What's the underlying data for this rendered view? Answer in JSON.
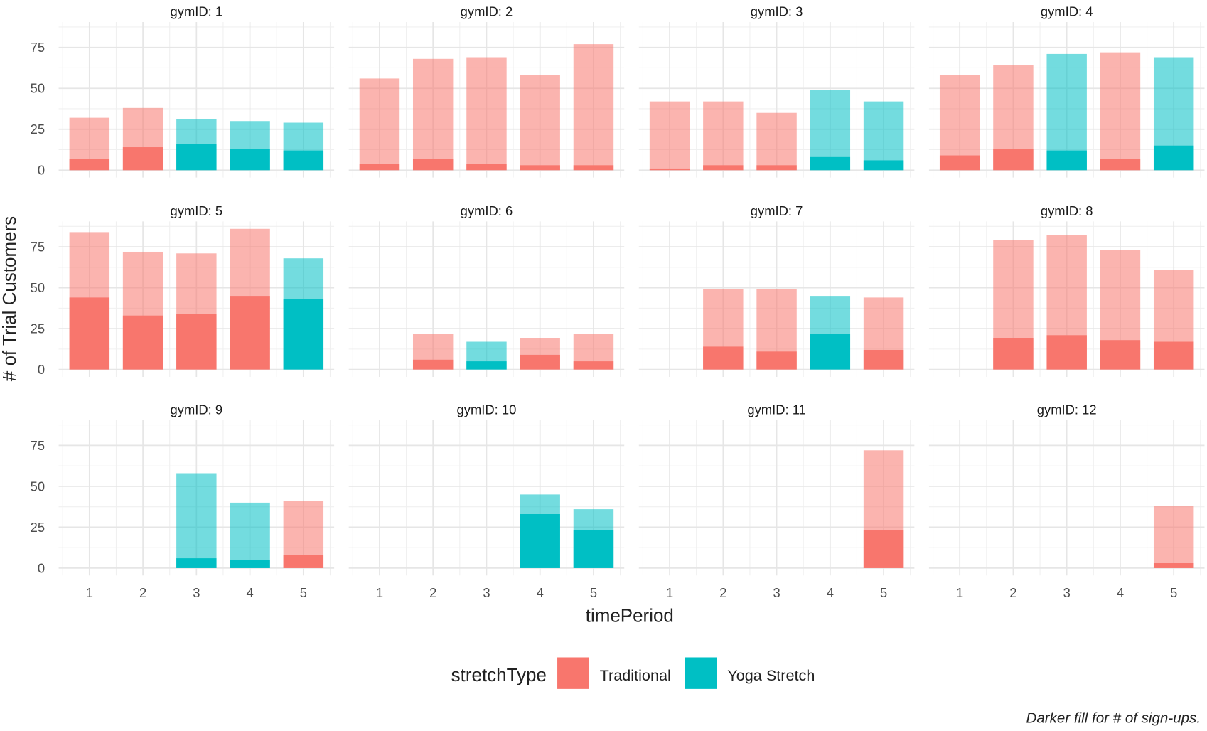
{
  "chart_data": {
    "type": "bar",
    "facet_label_prefix": "gymID: ",
    "xlabel": "timePeriod",
    "ylabel": "# of Trial Customers",
    "caption": "Darker fill for # of sign-ups.",
    "x_ticks": [
      1,
      2,
      3,
      4,
      5
    ],
    "y_ticks": [
      0,
      25,
      50,
      75
    ],
    "ylim": [
      0,
      90
    ],
    "grid": true,
    "legend": {
      "title": "stretchType",
      "placement": "bottom",
      "entries": [
        {
          "label": "Traditional",
          "color": "#F8766D"
        },
        {
          "label": "Yoga Stretch",
          "color": "#00BFC4"
        }
      ]
    },
    "series_note_fields": [
      "timePeriod",
      "total_trial_customers",
      "sign_ups",
      "stretchType"
    ],
    "panels": [
      {
        "gymID": 1,
        "bars": [
          [
            1,
            32,
            7,
            "Traditional"
          ],
          [
            2,
            38,
            14,
            "Traditional"
          ],
          [
            3,
            31,
            16,
            "Yoga Stretch"
          ],
          [
            4,
            30,
            13,
            "Yoga Stretch"
          ],
          [
            5,
            29,
            12,
            "Yoga Stretch"
          ]
        ]
      },
      {
        "gymID": 2,
        "bars": [
          [
            1,
            56,
            4,
            "Traditional"
          ],
          [
            2,
            68,
            7,
            "Traditional"
          ],
          [
            3,
            69,
            4,
            "Traditional"
          ],
          [
            4,
            58,
            3,
            "Traditional"
          ],
          [
            5,
            77,
            3,
            "Traditional"
          ]
        ]
      },
      {
        "gymID": 3,
        "bars": [
          [
            1,
            42,
            1,
            "Traditional"
          ],
          [
            2,
            42,
            3,
            "Traditional"
          ],
          [
            3,
            35,
            3,
            "Traditional"
          ],
          [
            4,
            49,
            8,
            "Yoga Stretch"
          ],
          [
            5,
            42,
            6,
            "Yoga Stretch"
          ]
        ]
      },
      {
        "gymID": 4,
        "bars": [
          [
            1,
            58,
            9,
            "Traditional"
          ],
          [
            2,
            64,
            13,
            "Traditional"
          ],
          [
            3,
            71,
            12,
            "Yoga Stretch"
          ],
          [
            4,
            72,
            7,
            "Traditional"
          ],
          [
            5,
            69,
            15,
            "Yoga Stretch"
          ]
        ]
      },
      {
        "gymID": 5,
        "bars": [
          [
            1,
            84,
            44,
            "Traditional"
          ],
          [
            2,
            72,
            33,
            "Traditional"
          ],
          [
            3,
            71,
            34,
            "Traditional"
          ],
          [
            4,
            86,
            45,
            "Traditional"
          ],
          [
            5,
            68,
            43,
            "Yoga Stretch"
          ]
        ]
      },
      {
        "gymID": 6,
        "bars": [
          [
            2,
            22,
            6,
            "Traditional"
          ],
          [
            3,
            17,
            5,
            "Yoga Stretch"
          ],
          [
            4,
            19,
            9,
            "Traditional"
          ],
          [
            5,
            22,
            5,
            "Traditional"
          ]
        ]
      },
      {
        "gymID": 7,
        "bars": [
          [
            2,
            49,
            14,
            "Traditional"
          ],
          [
            3,
            49,
            11,
            "Traditional"
          ],
          [
            4,
            45,
            22,
            "Yoga Stretch"
          ],
          [
            5,
            44,
            12,
            "Traditional"
          ]
        ]
      },
      {
        "gymID": 8,
        "bars": [
          [
            2,
            79,
            19,
            "Traditional"
          ],
          [
            3,
            82,
            21,
            "Traditional"
          ],
          [
            4,
            73,
            18,
            "Traditional"
          ],
          [
            5,
            61,
            17,
            "Traditional"
          ]
        ]
      },
      {
        "gymID": 9,
        "bars": [
          [
            3,
            58,
            6,
            "Yoga Stretch"
          ],
          [
            4,
            40,
            5,
            "Yoga Stretch"
          ],
          [
            5,
            41,
            8,
            "Traditional"
          ]
        ]
      },
      {
        "gymID": 10,
        "bars": [
          [
            4,
            45,
            33,
            "Yoga Stretch"
          ],
          [
            5,
            36,
            23,
            "Yoga Stretch"
          ]
        ]
      },
      {
        "gymID": 11,
        "bars": [
          [
            5,
            72,
            23,
            "Traditional"
          ]
        ]
      },
      {
        "gymID": 12,
        "bars": [
          [
            5,
            38,
            3,
            "Traditional"
          ]
        ]
      }
    ]
  }
}
